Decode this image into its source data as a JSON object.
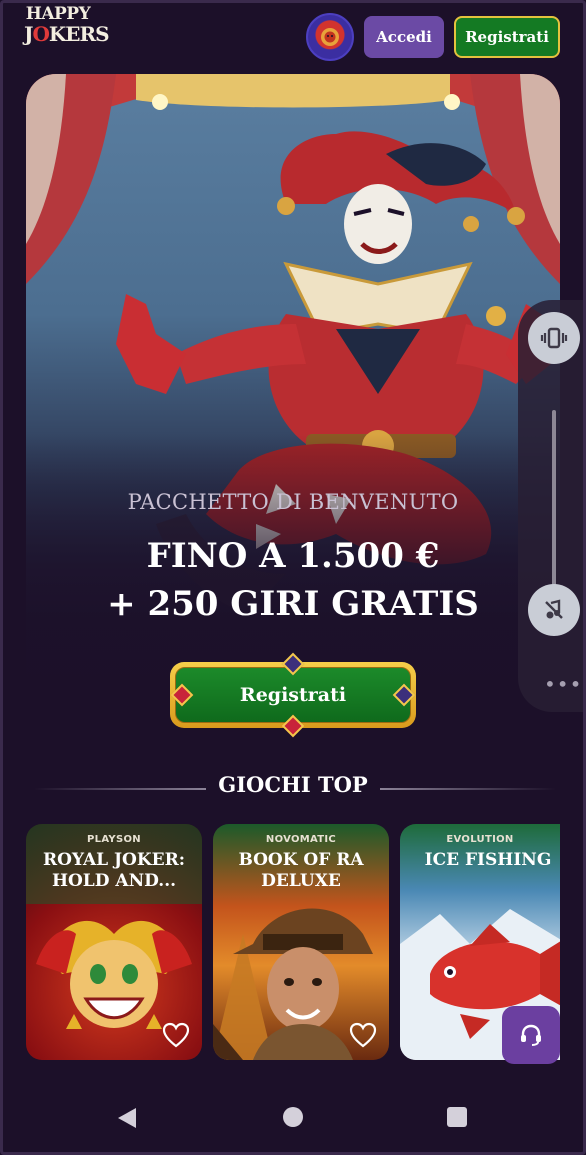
{
  "header": {
    "logo_line1": "HAPPY",
    "logo_line2_a": "J",
    "logo_line2_o": "O",
    "logo_line2_b": "KERS",
    "login_label": "Accedi",
    "register_label": "Registrati"
  },
  "hero": {
    "kicker": "PACCHETTO DI BENVENUTO",
    "headline_line1": "FINO A 1.500 €",
    "headline_line2": "+ 250 GIRI GRATIS",
    "cta_label": "Registrati"
  },
  "top_games": {
    "title": "GIOCHI TOP",
    "games": [
      {
        "provider": "PLAYSON",
        "name": "ROYAL JOKER: HOLD AND..."
      },
      {
        "provider": "NOVOMATIC",
        "name": "BOOK OF RA DELUXE"
      },
      {
        "provider": "EVOLUTION",
        "name": "ICE FISHING"
      }
    ]
  },
  "side_panel": {
    "icons": [
      "vibrate-icon",
      "mute-icon",
      "more-icon"
    ]
  },
  "colors": {
    "background": "#1c1029",
    "accent_purple": "#6b4aa5",
    "cta_green": "#147a23",
    "cta_gold": "#e3c23e"
  }
}
